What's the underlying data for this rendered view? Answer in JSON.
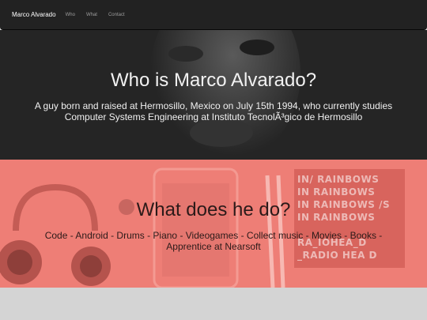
{
  "nav": {
    "brand": "Marco Alvarado",
    "links": [
      "Who",
      "What",
      "Contact"
    ]
  },
  "who": {
    "title": "Who is Marco Alvarado?",
    "subtitle": "A guy born and raised at Hermosillo, Mexico on July 15th 1994, who currently studies Computer Systems Engineering at Instituto TecnolÃ³gico de Hermosillo"
  },
  "what": {
    "title": "What does he do?",
    "subtitle": "Code - Android - Drums - Piano - Videogames - Collect music - Movies - Books - Apprentice at Nearsoft",
    "album_lines": [
      "IN/ RAINBOWS",
      "IN RAINBOWS",
      "IN RAINBOWS /S",
      "IN RAINBOWS",
      "RA_IOHEA_D",
      "_RADIO HEA D"
    ]
  },
  "colors": {
    "navbar": "#222222",
    "who_bg": "#252525",
    "what_bg": "#ee7e76",
    "page_bg": "#d4d4d4"
  }
}
